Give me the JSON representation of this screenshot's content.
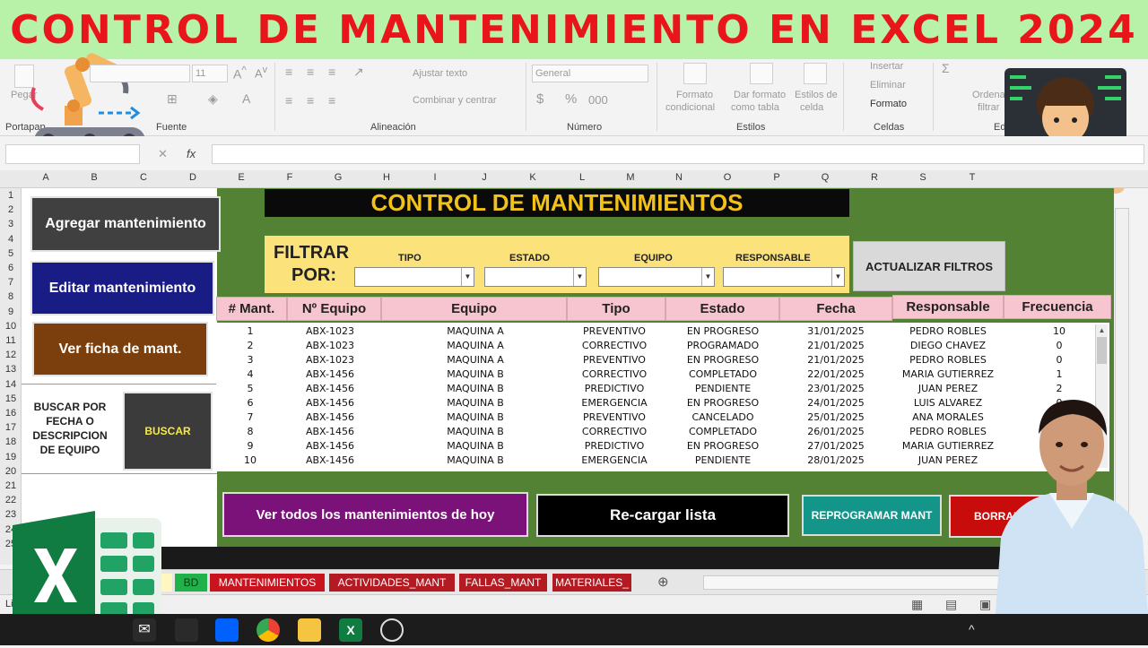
{
  "banner": {
    "title": "CONTROL DE MANTENIMIENTO EN EXCEL 2024"
  },
  "ribbon": {
    "portapapeles": "Portapap",
    "pegar": "Pegar",
    "fuente": "Fuente",
    "font_size": "11",
    "alineacion": "Alineación",
    "ajustar_texto": "Ajustar texto",
    "combinar": "Combinar y centrar",
    "numero": "Número",
    "general": "General",
    "formato_condicional_1": "Formato",
    "formato_condicional_2": "condicional",
    "dar_formato_1": "Dar formato",
    "dar_formato_2": "como tabla",
    "estilos_celda_1": "Estilos de",
    "estilos_celda_2": "celda",
    "estilos": "Estilos",
    "insertar": "Insertar",
    "eliminar": "Eliminar",
    "formato": "Formato",
    "celdas": "Celdas",
    "ordenar": "Ordena",
    "filtrar": "filtrar",
    "edicion": "Edi"
  },
  "formula_bar": {
    "fx": "fx"
  },
  "columns": [
    "A",
    "B",
    "C",
    "D",
    "E",
    "F",
    "G",
    "H",
    "I",
    "J",
    "K",
    "L",
    "M",
    "N",
    "O",
    "P",
    "Q",
    "R",
    "S",
    "T"
  ],
  "rows": [
    "1",
    "2",
    "3",
    "4",
    "5",
    "6",
    "7",
    "8",
    "9",
    "10",
    "11",
    "12",
    "13",
    "14",
    "15",
    "16",
    "17",
    "18",
    "19",
    "20",
    "21",
    "22",
    "23",
    "24",
    "25"
  ],
  "left_panel": {
    "agregar": "Agregar mantenimiento",
    "editar": "Editar mantenimiento",
    "ver_ficha": "Ver ficha de mant.",
    "buscar_label": "BUSCAR POR FECHA O DESCRIPCION DE EQUIPO",
    "buscar_btn": "BUSCAR"
  },
  "main": {
    "title": "CONTROL DE MANTENIMIENTOS",
    "filtrar": "FILTRAR",
    "por": "POR:",
    "tipo": "TIPO",
    "estado": "ESTADO",
    "equipo": "EQUIPO",
    "responsable": "RESPONSABLE",
    "actualizar": "ACTUALIZAR FILTROS"
  },
  "table": {
    "headers": [
      "# Mant.",
      "Nº Equipo",
      "Equipo",
      "Tipo",
      "Estado",
      "Fecha",
      "Responsable",
      "Frecuencia"
    ],
    "rows": [
      [
        "1",
        "ABX-1023",
        "MAQUINA A",
        "PREVENTIVO",
        "EN PROGRESO",
        "31/01/2025",
        "PEDRO ROBLES",
        "10"
      ],
      [
        "2",
        "ABX-1023",
        "MAQUINA A",
        "CORRECTIVO",
        "PROGRAMADO",
        "21/01/2025",
        "DIEGO CHAVEZ",
        "0"
      ],
      [
        "3",
        "ABX-1023",
        "MAQUINA A",
        "PREVENTIVO",
        "EN PROGRESO",
        "21/01/2025",
        "PEDRO ROBLES",
        "0"
      ],
      [
        "4",
        "ABX-1456",
        "MAQUINA B",
        "CORRECTIVO",
        "COMPLETADO",
        "22/01/2025",
        "MARIA GUTIERREZ",
        "1"
      ],
      [
        "5",
        "ABX-1456",
        "MAQUINA B",
        "PREDICTIVO",
        "PENDIENTE",
        "23/01/2025",
        "JUAN PEREZ",
        "2"
      ],
      [
        "6",
        "ABX-1456",
        "MAQUINA B",
        "EMERGENCIA",
        "EN PROGRESO",
        "24/01/2025",
        "LUIS ALVAREZ",
        "0"
      ],
      [
        "7",
        "ABX-1456",
        "MAQUINA B",
        "PREVENTIVO",
        "CANCELADO",
        "25/01/2025",
        "ANA MORALES",
        ""
      ],
      [
        "8",
        "ABX-1456",
        "MAQUINA B",
        "CORRECTIVO",
        "COMPLETADO",
        "26/01/2025",
        "PEDRO ROBLES",
        ""
      ],
      [
        "9",
        "ABX-1456",
        "MAQUINA B",
        "PREDICTIVO",
        "EN PROGRESO",
        "27/01/2025",
        "MARIA GUTIERREZ",
        ""
      ],
      [
        "10",
        "ABX-1456",
        "MAQUINA B",
        "EMERGENCIA",
        "PENDIENTE",
        "28/01/2025",
        "JUAN PEREZ",
        ""
      ]
    ]
  },
  "bottom_buttons": {
    "ver_todos": "Ver todos los mantenimientos de hoy",
    "recargar": "Re-cargar lista",
    "reprogramar": "REPROGRAMAR MANT",
    "borrar": "BORRAR MA"
  },
  "tabs": [
    "BD",
    "MANTENIMIENTOS",
    "ACTIVIDADES_MANT",
    "FALLAS_MANT",
    "MATERIALES_"
  ],
  "status": {
    "left": "Li"
  },
  "colors": {
    "banner_bg": "#b8f1a8",
    "banner_text": "#e8161b",
    "sheet_green": "#548235",
    "header_pink": "#f7c5cf",
    "filter_yellow": "#fce27a",
    "title_gold": "#f2c21a"
  }
}
